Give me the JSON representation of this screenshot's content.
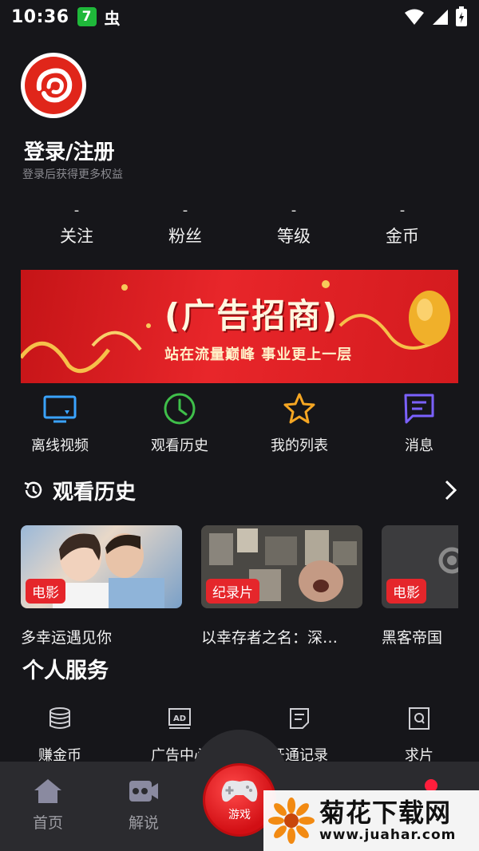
{
  "status_bar": {
    "time": "10:36",
    "badge": "7",
    "bug_glyph": "虫"
  },
  "profile": {
    "title": "登录/注册",
    "subtitle": "登录后获得更多权益"
  },
  "stats": [
    {
      "value": "-",
      "label": "关注"
    },
    {
      "value": "-",
      "label": "粉丝"
    },
    {
      "value": "-",
      "label": "等级"
    },
    {
      "value": "-",
      "label": "金币"
    }
  ],
  "banner": {
    "title": "(广告招商)",
    "subtitle": "站在流量巅峰  事业更上一层"
  },
  "quick_actions": [
    {
      "label": "离线视频",
      "icon": "offline-video-icon",
      "color": "#3aa3ff"
    },
    {
      "label": "观看历史",
      "icon": "clock-icon",
      "color": "#3fbf4a"
    },
    {
      "label": "我的列表",
      "icon": "star-icon",
      "color": "#f5a623"
    },
    {
      "label": "消息",
      "icon": "message-icon",
      "color": "#7b61ff"
    }
  ],
  "history": {
    "title": "观看历史",
    "items": [
      {
        "tag": "电影",
        "title": "多幸运遇见你"
      },
      {
        "tag": "纪录片",
        "title": "以幸存者之名：深…"
      },
      {
        "tag": "电影",
        "title": "黑客帝国"
      }
    ]
  },
  "services": {
    "title": "个人服务",
    "items": [
      {
        "label": "赚金币",
        "icon": "coins-icon"
      },
      {
        "label": "广告中心",
        "icon": "ad-icon"
      },
      {
        "label": "开通记录",
        "icon": "record-icon"
      },
      {
        "label": "求片",
        "icon": "search-film-icon"
      }
    ]
  },
  "tabbar": {
    "home": "首页",
    "explain": "解说",
    "game": "游戏"
  },
  "watermark": {
    "title": "菊花下载网",
    "url": "www.juahar.com"
  },
  "colors": {
    "accent_red": "#e5262b",
    "background": "#16161a",
    "tabbar": "#2b2b2f"
  }
}
